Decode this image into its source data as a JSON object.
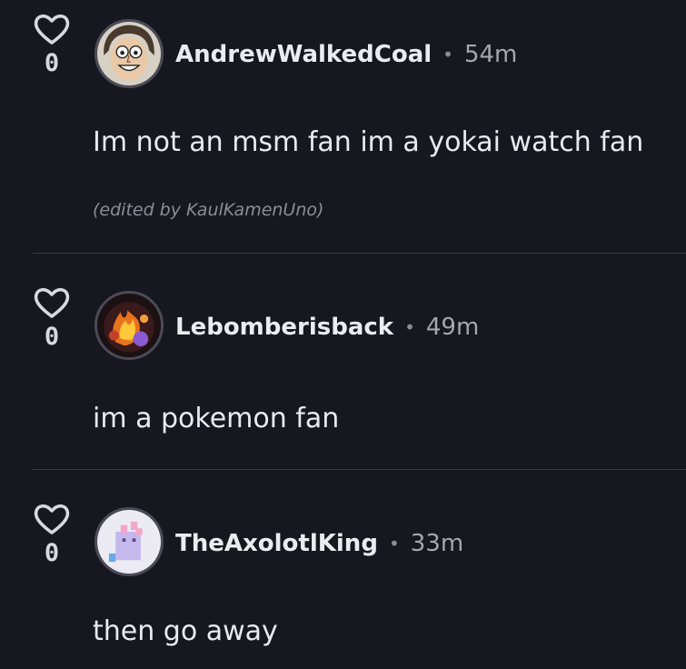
{
  "comments": [
    {
      "username": "AndrewWalkedCoal",
      "separator": "•",
      "time": "54m",
      "text": "Im not an msm fan im a yokai watch fan",
      "edited_note": "(edited by KaulKamenUno)",
      "likes": "0",
      "avatar_icon": "cartoon-face-avatar"
    },
    {
      "username": "Lebomberisback",
      "separator": "•",
      "time": "49m",
      "text": "im a pokemon fan",
      "likes": "0",
      "avatar_icon": "fire-creature-avatar"
    },
    {
      "username": "TheAxolotlKing",
      "separator": "•",
      "time": "33m",
      "text": "then go away",
      "likes": "0",
      "avatar_icon": "axolotl-avatar"
    }
  ],
  "colors": {
    "background": "#16171f",
    "divider": "#3a3b46",
    "text_primary": "#eaeaee",
    "text_muted": "#a5a6b0"
  }
}
